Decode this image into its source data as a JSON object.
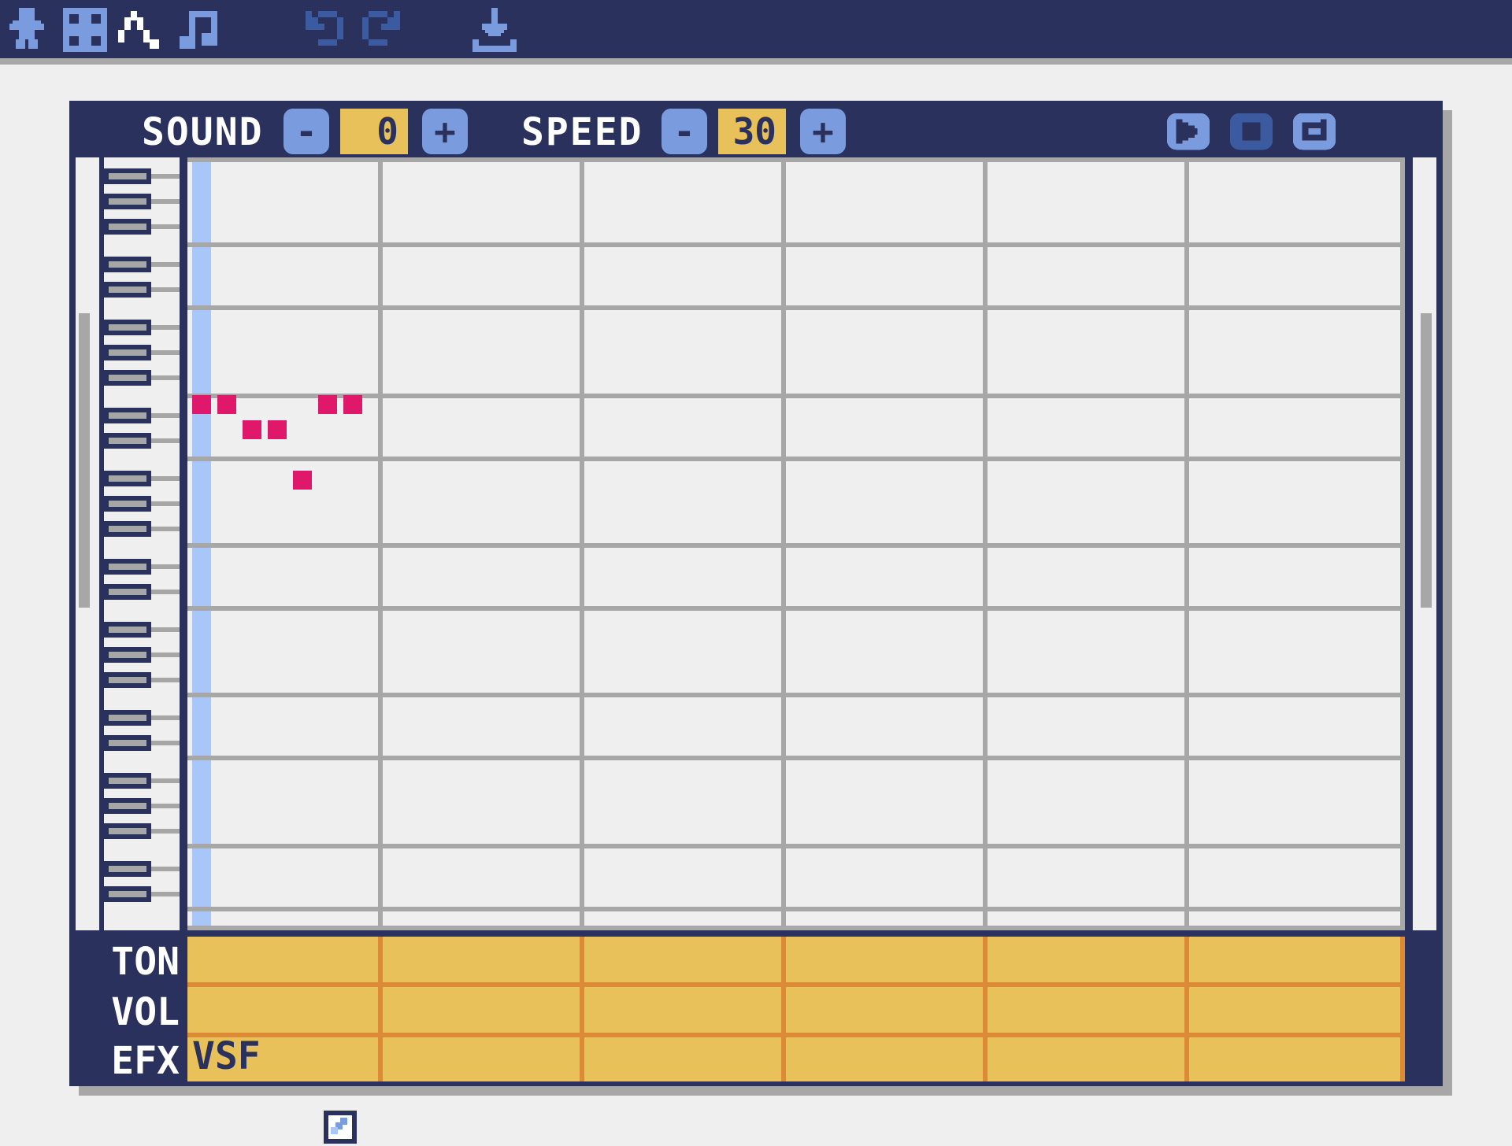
{
  "app": {
    "toolbar": {
      "editors": [
        {
          "name": "image-editor",
          "icon": "sprite-figure-icon"
        },
        {
          "name": "tilemap-editor",
          "icon": "grid-icon"
        },
        {
          "name": "sound-editor",
          "icon": "wave-icon"
        },
        {
          "name": "music-editor",
          "icon": "music-note-icon"
        }
      ],
      "actions": [
        {
          "name": "undo",
          "icon": "undo-icon"
        },
        {
          "name": "redo",
          "icon": "redo-icon"
        },
        {
          "name": "save",
          "icon": "download-icon"
        }
      ]
    },
    "header": {
      "sound_label": "SOUND",
      "sound_value": "0",
      "speed_label": "SPEED",
      "speed_value": "30",
      "minus": "-",
      "plus": "+",
      "controls": [
        {
          "name": "play",
          "icon": "play-icon"
        },
        {
          "name": "stop",
          "icon": "stop-icon"
        },
        {
          "name": "loop",
          "icon": "loop-icon"
        }
      ]
    },
    "rows": {
      "tone_label": "TON",
      "volume_label": "VOL",
      "effect_label": "EFX",
      "effect_value": "VSF"
    },
    "notes": [
      {
        "step": 0,
        "pitch_row": 9
      },
      {
        "step": 1,
        "pitch_row": 9
      },
      {
        "step": 2,
        "pitch_row": 10
      },
      {
        "step": 3,
        "pitch_row": 10
      },
      {
        "step": 4,
        "pitch_row": 12
      },
      {
        "step": 5,
        "pitch_row": 9
      },
      {
        "step": 6,
        "pitch_row": 9
      }
    ],
    "playhead_step": 0,
    "colors": {
      "navy": "#29315c",
      "accent_blue": "#7a9cdf",
      "value_yellow": "#e8c15a",
      "note_pink": "#e0186b",
      "playhead_blue": "#a8c6f8",
      "grid_gray": "#a7a7a7",
      "row_line_orange": "#dc8a35"
    }
  }
}
